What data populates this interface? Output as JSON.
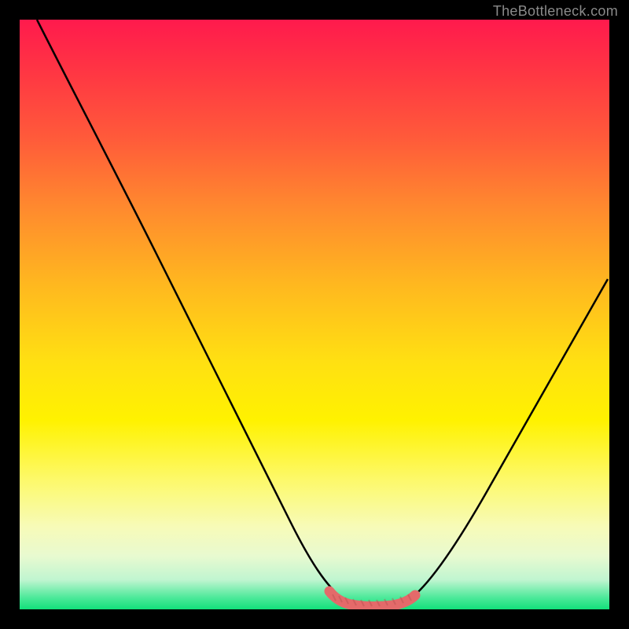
{
  "watermark": "TheBottleneck.com",
  "chart_data": {
    "type": "line",
    "title": "",
    "xlabel": "",
    "ylabel": "",
    "xlim": [
      0,
      100
    ],
    "ylim": [
      0,
      100
    ],
    "background_gradient": {
      "top": "#ff1a4d",
      "mid_upper": "#ffb81f",
      "mid_lower": "#fff200",
      "bottom": "#12e07a"
    },
    "series": [
      {
        "name": "curve",
        "color": "#000000",
        "x": [
          3,
          10,
          18,
          26,
          34,
          42,
          48,
          52,
          55,
          58,
          62,
          65,
          70,
          76,
          82,
          88,
          94,
          99
        ],
        "y": [
          100,
          88,
          75,
          62,
          48,
          34,
          20,
          10,
          4,
          1,
          1,
          3,
          8,
          17,
          28,
          38,
          48,
          56
        ]
      },
      {
        "name": "highlight-band",
        "color": "#e46a6a",
        "x": [
          52,
          55,
          58,
          62,
          65
        ],
        "y": [
          2,
          1,
          0.5,
          1,
          2
        ]
      }
    ]
  }
}
